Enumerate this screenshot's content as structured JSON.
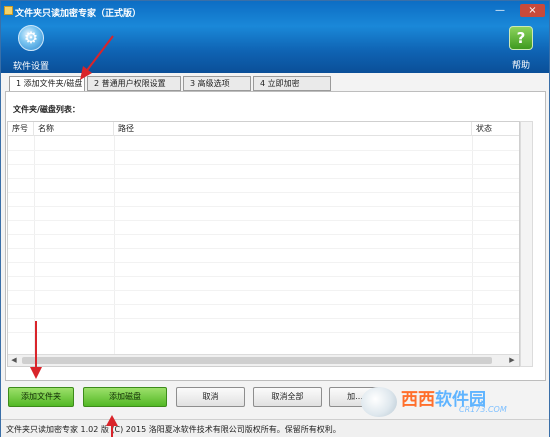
{
  "window": {
    "title": "文件夹只读加密专家（正式版）",
    "minimize_glyph": "—",
    "close_glyph": "×"
  },
  "toolbar": {
    "settings_label": "软件设置",
    "help_label": "帮助",
    "settings_icon": "gear-icon",
    "help_icon": "question-icon"
  },
  "tabs": [
    {
      "label": "1 添加文件夹/磁盘",
      "active": true
    },
    {
      "label": "2 普通用户权限设置",
      "active": false
    },
    {
      "label": "3 高级选项",
      "active": false
    },
    {
      "label": "4 立即加密",
      "active": false
    }
  ],
  "list": {
    "caption": "文件夹/磁盘列表：",
    "columns": [
      "序号",
      "名称",
      "路径",
      "状态"
    ],
    "rows": []
  },
  "buttons": {
    "add_folder": "添加文件夹",
    "add_disk": "添加磁盘",
    "cancel": "取消",
    "cancel_all": "取消全部",
    "fourth": "加..."
  },
  "status": {
    "text": "文件夹只读加密专家 1.02 版  (C) 2015 洛阳夏冰软件技术有限公司版权所有。保留所有权利。"
  },
  "watermark": {
    "brand_a": "西西",
    "brand_b": "软件园",
    "url": "CR173.COM"
  },
  "colors": {
    "header": "#0f63b3",
    "annotation_arrow": "#d9242a",
    "green_button": "#53b825"
  }
}
